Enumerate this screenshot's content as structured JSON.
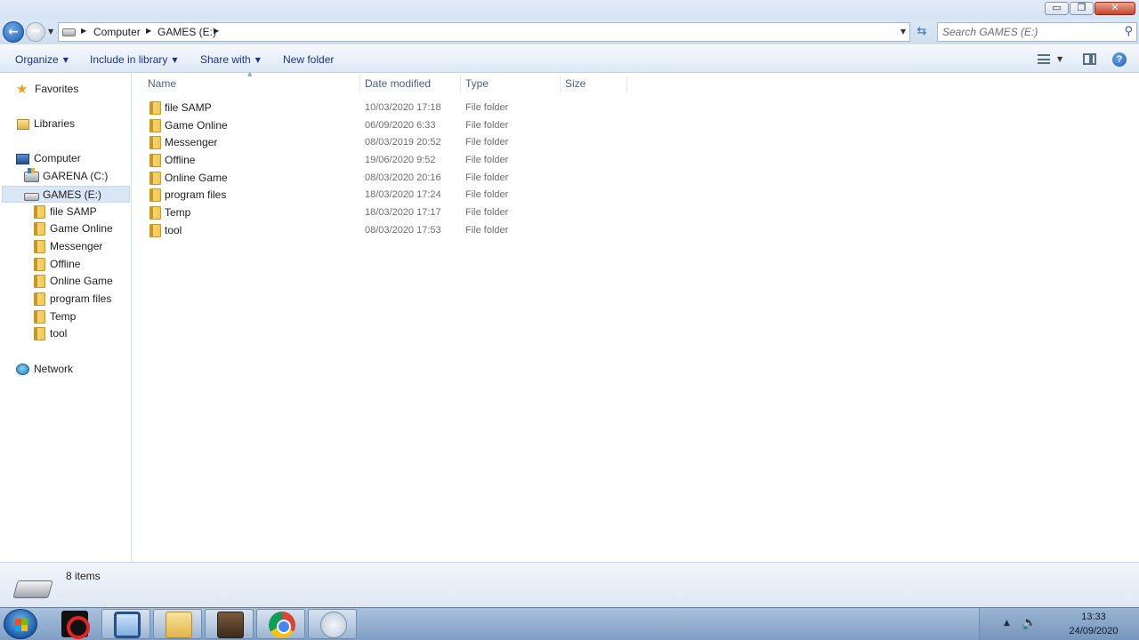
{
  "window": {
    "minimize_glyph": "▭",
    "restore_glyph": "❐",
    "close_glyph": "✕"
  },
  "address": {
    "crumbs": [
      "Computer",
      "GAMES (E:)"
    ],
    "search_placeholder": "Search GAMES (E:)"
  },
  "toolbar": {
    "organize": "Organize",
    "include_in_library": "Include in library",
    "share_with": "Share with",
    "new_folder": "New folder",
    "help": "?"
  },
  "sidebar": {
    "favorites": "Favorites",
    "libraries": "Libraries",
    "computer": "Computer",
    "drives": [
      "GARENA (C:)",
      "GAMES (E:)"
    ],
    "folders": [
      "file SAMP",
      "Game Online",
      "Messenger",
      "Offline",
      "Online Game",
      "program files",
      "Temp",
      "tool"
    ],
    "network": "Network"
  },
  "columns": {
    "name": "Name",
    "date_modified": "Date modified",
    "type": "Type",
    "size": "Size"
  },
  "files": [
    {
      "name": "file SAMP",
      "date": "10/03/2020 17:18",
      "type": "File folder"
    },
    {
      "name": "Game Online",
      "date": "06/09/2020 6:33",
      "type": "File folder"
    },
    {
      "name": "Messenger",
      "date": "08/03/2019 20:52",
      "type": "File folder"
    },
    {
      "name": "Offline",
      "date": "19/06/2020 9:52",
      "type": "File folder"
    },
    {
      "name": "Online Game",
      "date": "08/03/2020 20:16",
      "type": "File folder"
    },
    {
      "name": "program files",
      "date": "18/03/2020 17:24",
      "type": "File folder"
    },
    {
      "name": "Temp",
      "date": "18/03/2020 17:17",
      "type": "File folder"
    },
    {
      "name": "tool",
      "date": "08/03/2020 17:53",
      "type": "File folder"
    }
  ],
  "status": {
    "items_count": "8 items"
  },
  "taskbar": {
    "apps": [
      "garena-icon",
      "remote-desktop-icon",
      "windows-explorer-icon",
      "samp-game-icon",
      "chrome-icon",
      "paint-icon"
    ],
    "active_app": "windows-explorer-icon",
    "time": "13:33",
    "date": "24/09/2020"
  },
  "colors": {
    "accent": "#1e3287",
    "selection": "#d9e6f5"
  }
}
